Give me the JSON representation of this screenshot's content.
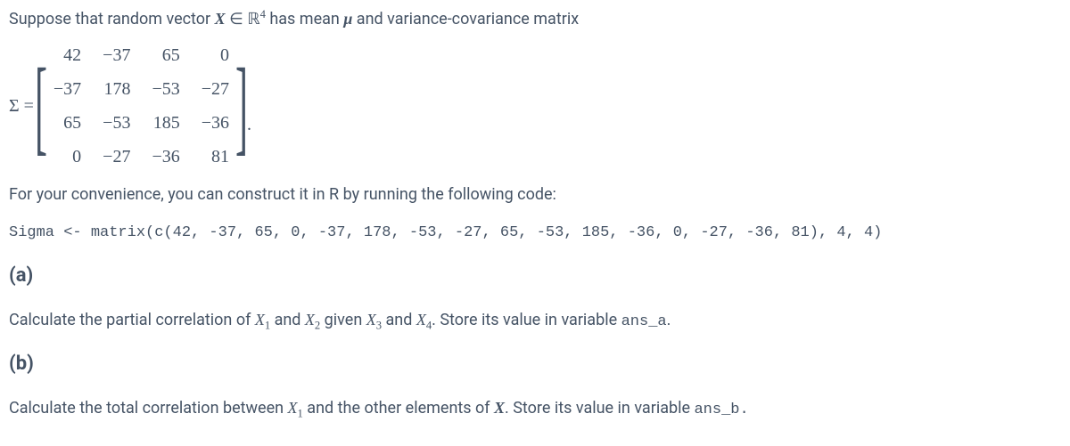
{
  "intro": {
    "part1": "Suppose that random vector ",
    "var": "X",
    "in": " ∈ ",
    "space": "ℝ",
    "sup": "4",
    "part2": " has mean ",
    "mu": "μ",
    "part3": " and variance-covariance matrix"
  },
  "matrix": {
    "lhs": "Σ =",
    "rows": [
      [
        "42",
        "−37",
        "65",
        "0"
      ],
      [
        "−37",
        "178",
        "−53",
        "−27"
      ],
      [
        "65",
        "−53",
        "185",
        "−36"
      ],
      [
        "0",
        "−27",
        "−36",
        "81"
      ]
    ],
    "period": "."
  },
  "convenience": "For your convenience, you can construct it in R by running the following code:",
  "code": "Sigma <- matrix(c(42, -37, 65, 0, -37, 178, -53, -27, 65, -53, 185, -36, 0, -27, -36, 81), 4, 4)",
  "parts": {
    "a_label": "(a)",
    "a_text1": "Calculate the partial correlation of ",
    "X1": "X",
    "s1": "1",
    "and": " and ",
    "X2": "X",
    "s2": "2",
    "given": " given ",
    "X3": "X",
    "s3": "3",
    "X4": "X",
    "s4": "4",
    "a_text2": ". Store its value in variable ",
    "a_var": "ans_a",
    "a_dot": ".",
    "b_label": "(b)",
    "b_text1": "Calculate the total correlation between ",
    "b_X1": "X",
    "b_s1": "1",
    "b_text2": " and the other elements of ",
    "b_Xvec": "X",
    "b_text3": ". Store its value in variable ",
    "b_var": "ans_b",
    "b_dot": "."
  }
}
